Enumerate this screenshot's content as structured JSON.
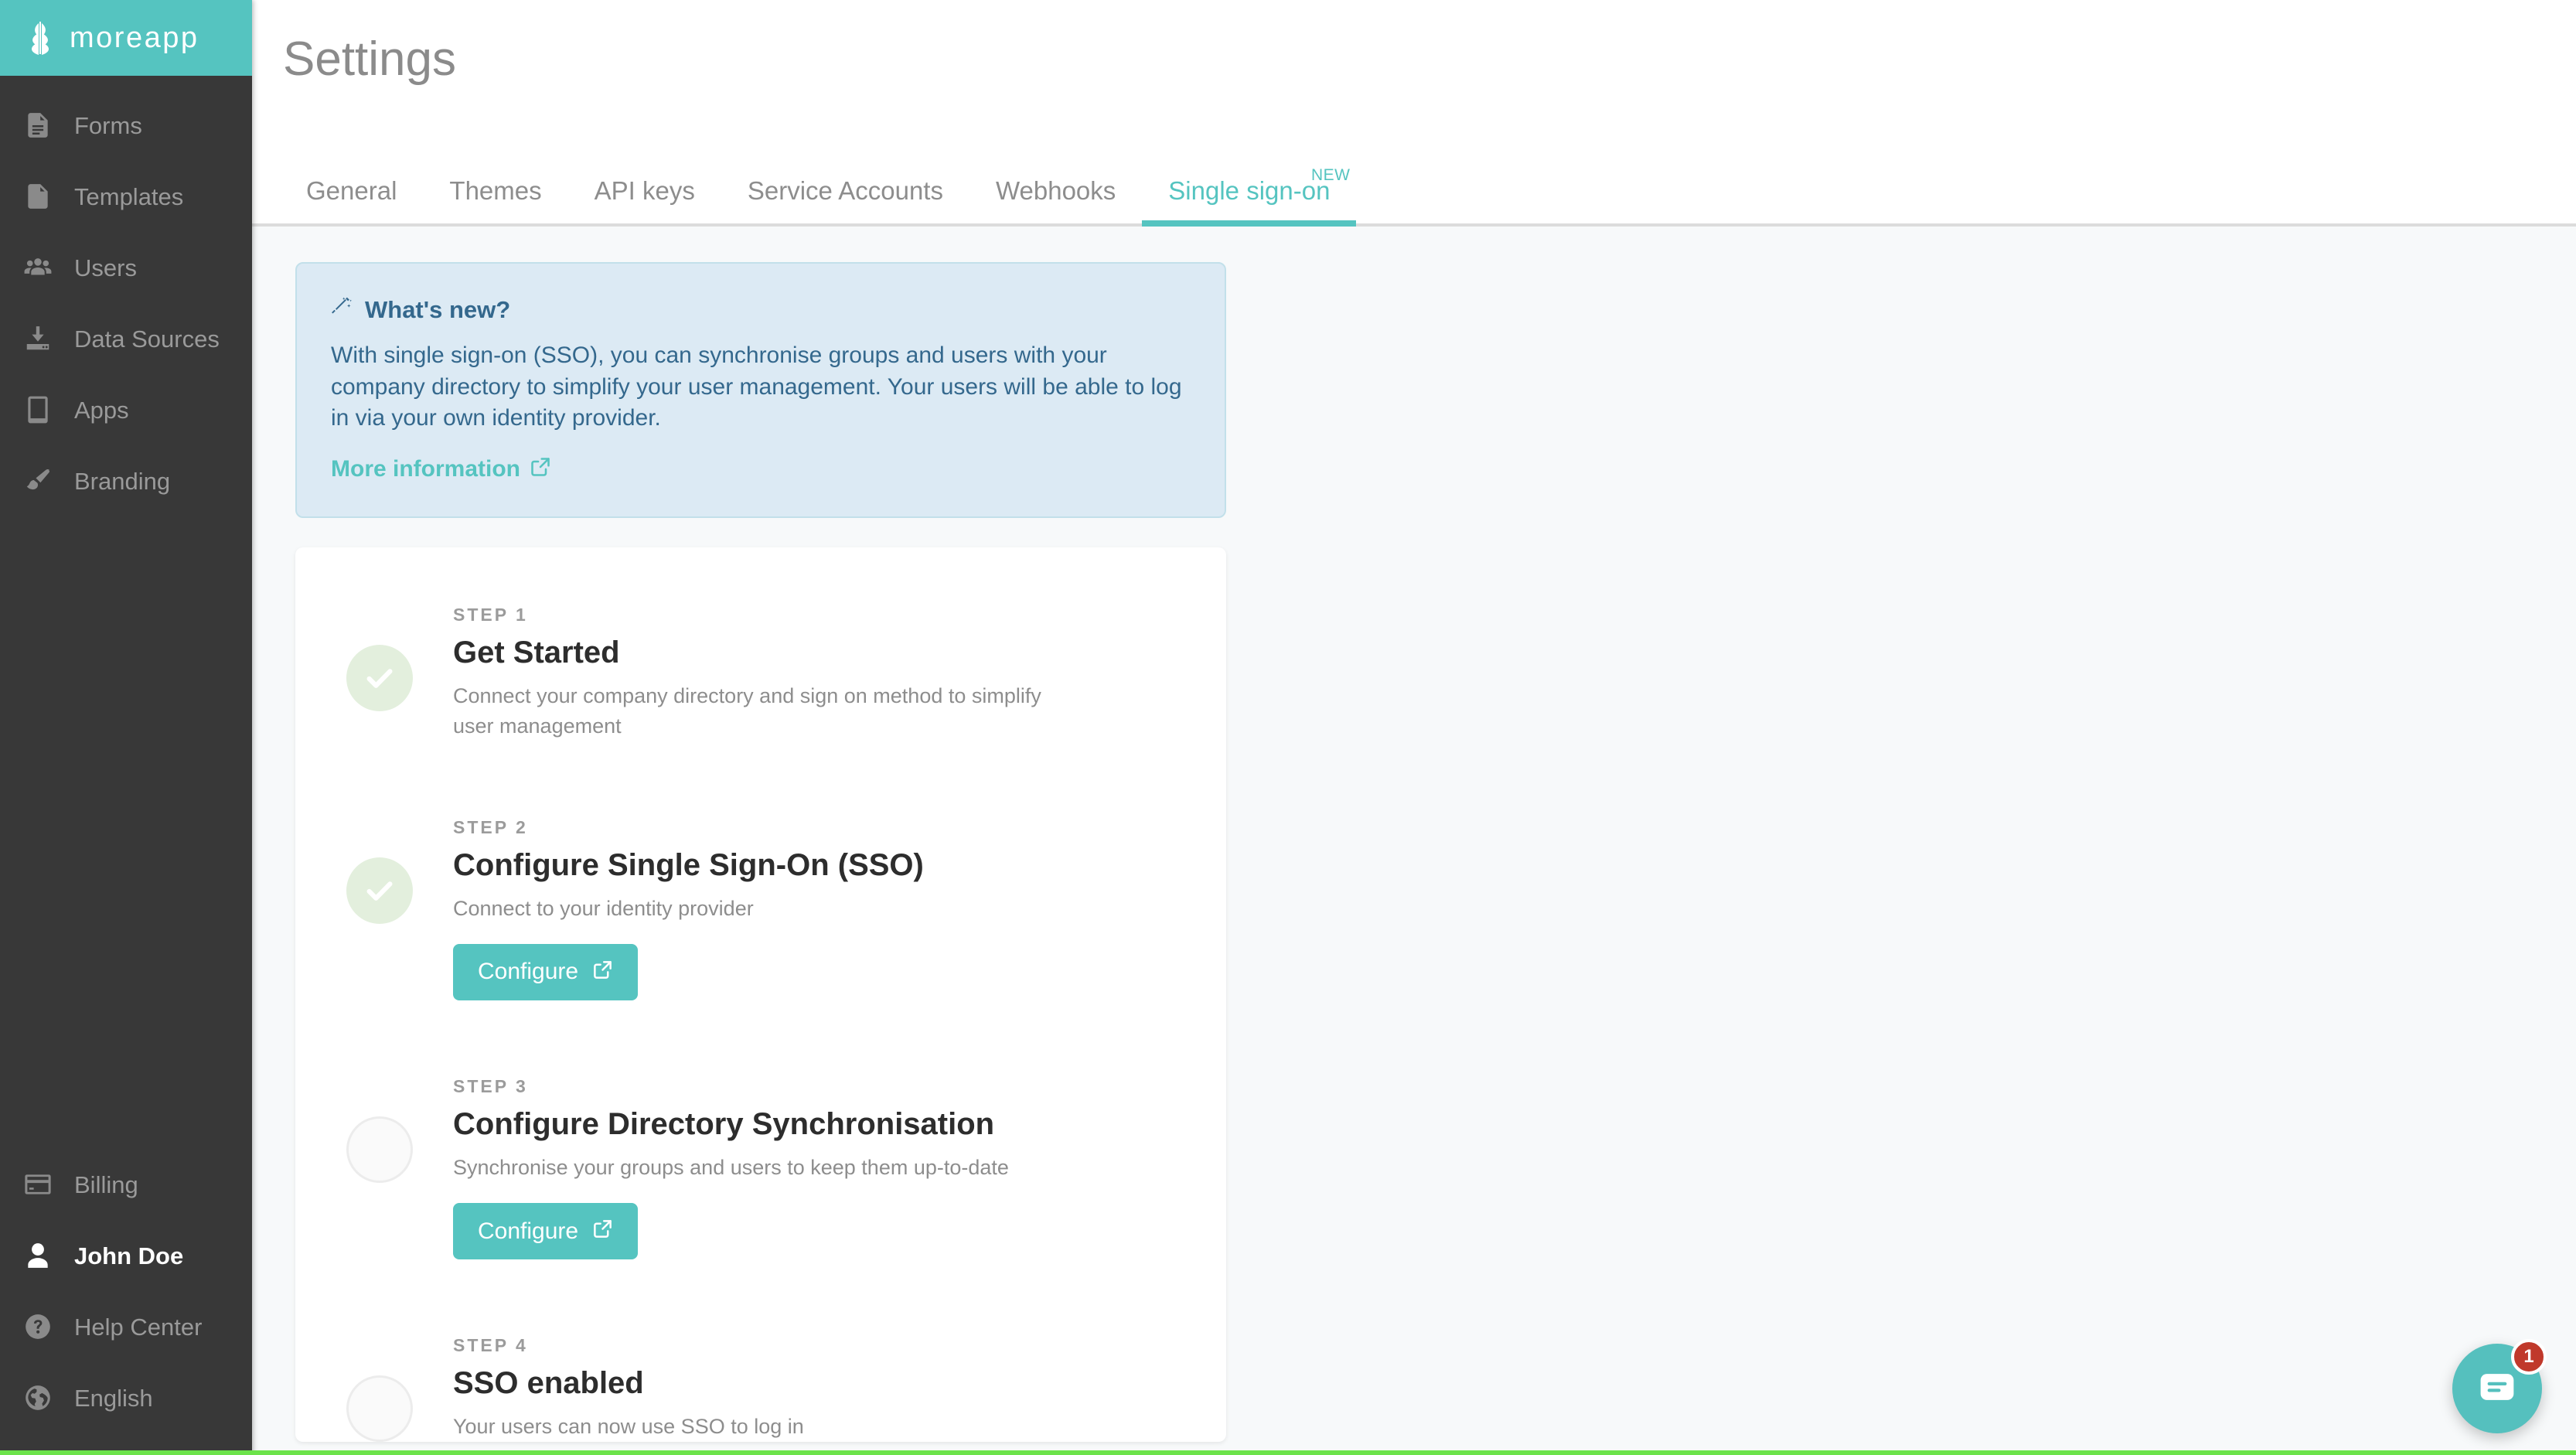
{
  "brand": {
    "name": "moreapp",
    "logo_icon": "leaf-icon",
    "bar_color": "#55c4c0"
  },
  "sidebar": {
    "background_color": "#383838",
    "primary_items": [
      {
        "label": "Forms",
        "icon": "document-lines-icon",
        "active": false
      },
      {
        "label": "Templates",
        "icon": "document-blank-icon",
        "active": false
      },
      {
        "label": "Users",
        "icon": "users-group-icon",
        "active": false
      },
      {
        "label": "Data Sources",
        "icon": "download-tray-icon",
        "active": false
      },
      {
        "label": "Apps",
        "icon": "tablet-icon",
        "active": false
      },
      {
        "label": "Branding",
        "icon": "paintbrush-icon",
        "active": false
      }
    ],
    "bottom_items": [
      {
        "label": "Billing",
        "icon": "credit-card-icon",
        "active": false
      },
      {
        "label": "John Doe",
        "icon": "user-icon",
        "active": true
      },
      {
        "label": "Help Center",
        "icon": "question-circle-icon",
        "active": false
      },
      {
        "label": "English",
        "icon": "globe-icon",
        "active": false
      }
    ]
  },
  "header": {
    "title": "Settings"
  },
  "tabs": [
    {
      "label": "General",
      "active": false,
      "badge": ""
    },
    {
      "label": "Themes",
      "active": false,
      "badge": ""
    },
    {
      "label": "API keys",
      "active": false,
      "badge": ""
    },
    {
      "label": "Service Accounts",
      "active": false,
      "badge": ""
    },
    {
      "label": "Webhooks",
      "active": false,
      "badge": ""
    },
    {
      "label": "Single sign-on",
      "active": true,
      "badge": "NEW"
    }
  ],
  "whats_new": {
    "icon": "magic-wand-icon",
    "title": "What's new?",
    "body": "With single sign-on (SSO), you can synchronise groups and users with your company directory to simplify your user management. Your users will be able to log in via your own identity provider.",
    "link_label": "More information",
    "link_icon": "external-link-icon",
    "background_color": "#dceaf4",
    "text_color": "#34688d",
    "link_color": "#55c4c0"
  },
  "steps": [
    {
      "kicker": "STEP 1",
      "title": "Get Started",
      "description": "Connect your company directory and sign on method to simplify user management",
      "state": "done",
      "marker_icon": "check-icon",
      "button": null
    },
    {
      "kicker": "STEP 2",
      "title": "Configure Single Sign-On (SSO)",
      "description": "Connect to your identity provider",
      "state": "done",
      "marker_icon": "check-icon",
      "button": {
        "label": "Configure",
        "icon": "external-link-icon"
      }
    },
    {
      "kicker": "STEP 3",
      "title": "Configure Directory Synchronisation",
      "description": "Synchronise your groups and users to keep them up-to-date",
      "state": "todo",
      "marker_icon": "empty-circle-icon",
      "button": {
        "label": "Configure",
        "icon": "external-link-icon"
      }
    },
    {
      "kicker": "STEP 4",
      "title": "SSO enabled",
      "description": "Your users can now use SSO to log in",
      "state": "todo",
      "marker_icon": "empty-circle-icon",
      "button": null
    }
  ],
  "chat_widget": {
    "icon": "chat-bubble-icon",
    "unread_count": "1",
    "color": "#55c0be",
    "badge_color": "#c0392b"
  },
  "accent_color": "#55c4c0"
}
